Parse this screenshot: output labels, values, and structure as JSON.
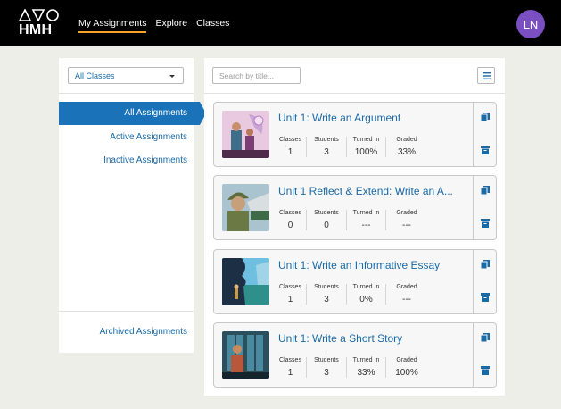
{
  "header": {
    "logo_text": "HMH",
    "nav": [
      "My Assignments",
      "Explore",
      "Classes"
    ],
    "active_nav": "My Assignments",
    "avatar_initials": "LN",
    "colors": {
      "bar": "#000000",
      "active_underline": "#f5a623",
      "avatar": "#7a4fc1"
    }
  },
  "sidebar": {
    "class_filter": "All Classes",
    "items": [
      "All Assignments",
      "Active Assignments",
      "Inactive Assignments"
    ],
    "archived": "Archived Assignments",
    "active_color": "#1a73b8"
  },
  "main": {
    "search_placeholder": "Search by title...",
    "menu_icon": "list-icon",
    "stat_labels": [
      "Classes",
      "Students",
      "Turned In",
      "Graded"
    ],
    "assignments": [
      {
        "title": "Unit 1: Write an Argument",
        "thumb": "argument-art",
        "classes": "1",
        "students": "3",
        "turned_in": "100%",
        "graded": "33%"
      },
      {
        "title": "Unit 1 Reflect & Extend: Write an A...",
        "thumb": "soldier-art",
        "classes": "0",
        "students": "0",
        "turned_in": "---",
        "graded": "---"
      },
      {
        "title": "Unit 1: Write an Informative Essay",
        "thumb": "silhouette-art",
        "classes": "1",
        "students": "3",
        "turned_in": "0%",
        "graded": "---"
      },
      {
        "title": "Unit 1: Write a Short Story",
        "thumb": "window-art",
        "classes": "1",
        "students": "3",
        "turned_in": "33%",
        "graded": "100%"
      }
    ]
  }
}
